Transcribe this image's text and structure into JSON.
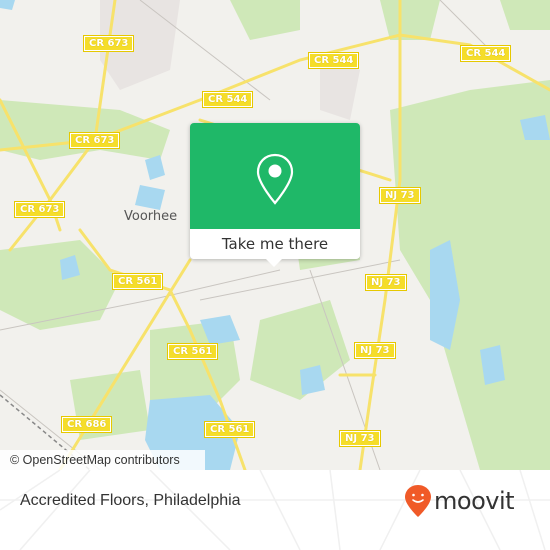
{
  "map": {
    "road_labels": [
      {
        "id": "cr673-a",
        "text": "CR 673"
      },
      {
        "id": "cr673-b",
        "text": "CR 673"
      },
      {
        "id": "cr673-c",
        "text": "CR 673"
      },
      {
        "id": "cr544-a",
        "text": "CR 544"
      },
      {
        "id": "cr544-b",
        "text": "CR 544"
      },
      {
        "id": "cr544-c",
        "text": "CR 544"
      },
      {
        "id": "nj73-a",
        "text": "NJ 73"
      },
      {
        "id": "nj73-b",
        "text": "NJ 73"
      },
      {
        "id": "nj73-c",
        "text": "NJ 73"
      },
      {
        "id": "nj73-d",
        "text": "NJ 73"
      },
      {
        "id": "cr561-a",
        "text": "CR 561"
      },
      {
        "id": "cr561-b",
        "text": "CR 561"
      },
      {
        "id": "cr561-c",
        "text": "CR 561"
      },
      {
        "id": "cr686",
        "text": "CR 686"
      }
    ],
    "town_label": "Voorhee",
    "colors": {
      "land": "#f2f1ed",
      "park": "#c8e6b0",
      "water": "#a8d8f0",
      "road": "#f7e26b"
    }
  },
  "popup": {
    "icon": "map-pin-icon",
    "button_label": "Take me there",
    "color": "#1fb868"
  },
  "attribution": "© OpenStreetMap contributors",
  "footer": {
    "place_name": "Accredited Floors, Philadelphia",
    "brand": "moovit",
    "brand_color": "#f05a28"
  }
}
